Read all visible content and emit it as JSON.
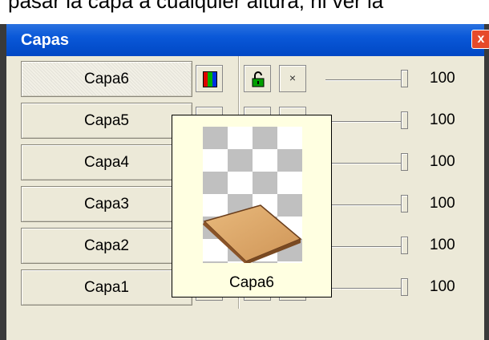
{
  "window": {
    "title": "Capas",
    "close_label": "x"
  },
  "layers": [
    {
      "name": "Capa6",
      "opacity": 100,
      "selected": true
    },
    {
      "name": "Capa5",
      "opacity": 100,
      "selected": false
    },
    {
      "name": "Capa4",
      "opacity": 100,
      "selected": false
    },
    {
      "name": "Capa3",
      "opacity": 100,
      "selected": false
    },
    {
      "name": "Capa2",
      "opacity": 100,
      "selected": false
    },
    {
      "name": "Capa1",
      "opacity": 100,
      "selected": false
    }
  ],
  "row_buttons": {
    "color_icon": "rgb-bars-icon",
    "lock_icon": "lock-open-icon",
    "delete_label": "×"
  },
  "tooltip": {
    "label": "Capa6",
    "thumbnail": "wood-board-on-transparent-grid"
  },
  "top_fragment": "pasar la capa a cualquier altura, ni ver la",
  "colors": {
    "titlebar": "#0a58d8",
    "panel": "#ece9d8",
    "tooltip_bg": "#ffffe1",
    "lock_green": "#00a000"
  }
}
